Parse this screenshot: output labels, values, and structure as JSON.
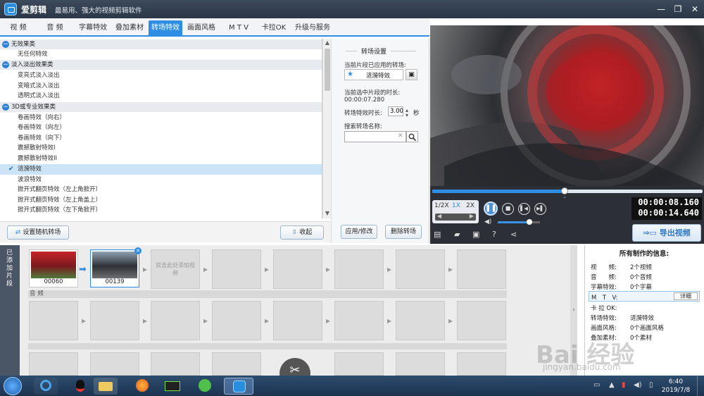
{
  "titlebar": {
    "app_name": "爱剪辑",
    "slogan": "最易用、强大的视频剪辑软件",
    "min": "—",
    "restore": "❐",
    "close": "✕"
  },
  "tabs": [
    "视 频",
    "音 频",
    "字幕特效",
    "叠加素材",
    "转场特效",
    "画面风格",
    "M T V",
    "卡拉OK",
    "升级与服务"
  ],
  "active_tab": 4,
  "effects": [
    {
      "type": "cat",
      "label": "无效果类"
    },
    {
      "type": "item",
      "label": "无任何特效"
    },
    {
      "type": "cat",
      "label": "淡入淡出效果类"
    },
    {
      "type": "item",
      "label": "变亮式淡入淡出"
    },
    {
      "type": "item",
      "label": "变暗式淡入淡出"
    },
    {
      "type": "item",
      "label": "透明式淡入淡出"
    },
    {
      "type": "cat",
      "label": "3D或专业效果类"
    },
    {
      "type": "item",
      "label": "卷画特效（向右）"
    },
    {
      "type": "item",
      "label": "卷画特效（向左）"
    },
    {
      "type": "item",
      "label": "卷画特效（向下）"
    },
    {
      "type": "item",
      "label": "震撼散射特效I"
    },
    {
      "type": "item",
      "label": "震撼散射特效II"
    },
    {
      "type": "item",
      "label": "涟漪特效",
      "selected": true
    },
    {
      "type": "item",
      "label": "波浪特效"
    },
    {
      "type": "item",
      "label": "掀开式翻页特效（左上角掀开）"
    },
    {
      "type": "item",
      "label": "掀开式翻页特效（左上角盖上）"
    },
    {
      "type": "item",
      "label": "掀开式翻页特效（左下角掀开）"
    }
  ],
  "leftbar": {
    "random_btn": "设置随机转场",
    "collapse_btn": "收起"
  },
  "settings": {
    "title": "转场设置",
    "current_label": "当前片段已应用的转场:",
    "current_value": "涟漪特效",
    "duration_label": "当前选中片段的时长:",
    "duration_value": "00:00:07.280",
    "effect_len_label": "转场特效时长:",
    "effect_len_value": "3.00",
    "effect_len_unit": "秒",
    "search_label": "搜索转场名称:",
    "search_value": "",
    "apply_btn": "应用/修改",
    "delete_btn": "删除转场"
  },
  "player": {
    "speed": [
      "1/2X",
      "1X",
      "2X"
    ],
    "time_current": "00:00:08.160",
    "time_total": "00:00:14.640",
    "progress": 0.49,
    "volume": 0.75,
    "export_btn": "导出视频"
  },
  "timeline": {
    "side_label": "已添加片段",
    "clips": [
      {
        "label": "00060"
      },
      {
        "label": "00139"
      }
    ],
    "placeholder": "双击此处添加视频",
    "audio_label": "音 频"
  },
  "info": {
    "title": "所有制作的信息:",
    "rows": [
      {
        "k": "视　　频:",
        "v": "2个视频"
      },
      {
        "k": "音　　频:",
        "v": "0个音频"
      },
      {
        "k": "字幕特效:",
        "v": "0个字幕"
      },
      {
        "k": "M　T　V:",
        "v": ""
      },
      {
        "k": "卡 拉 OK:",
        "v": ""
      },
      {
        "k": "转场特效:",
        "v": "涟漪特效"
      },
      {
        "k": "画面风格:",
        "v": "0个画面风格"
      },
      {
        "k": "叠加素材:",
        "v": "0个素材"
      }
    ],
    "detail_btn": "详细"
  },
  "taskbar": {
    "time": "6:40",
    "date": "2019/7/8"
  },
  "watermark": {
    "text": "Bai 经验",
    "url": "jingyan.baidu.com"
  }
}
